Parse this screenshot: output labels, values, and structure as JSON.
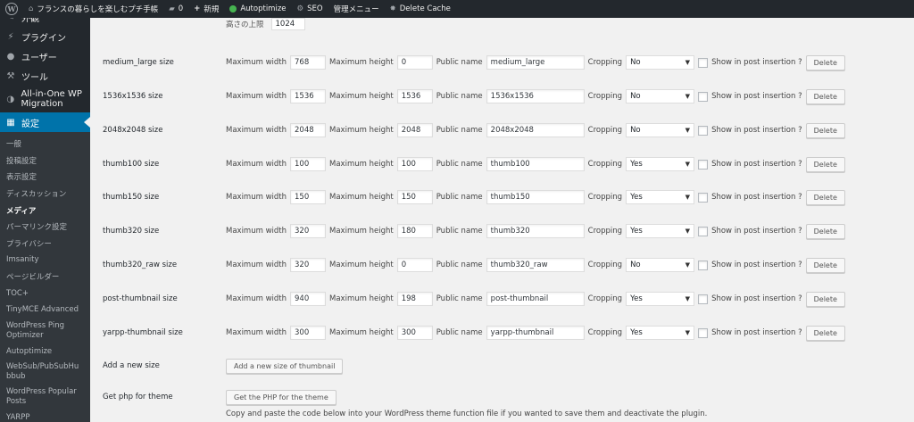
{
  "adminbar": {
    "site_name": "フランスの暮らしを楽しむプチ手帳",
    "comments_count": "0",
    "new_label": "新規",
    "autoptimize": "Autoptimize",
    "seo": "SEO",
    "admin_menu": "管理メニュー",
    "delete_cache": "Delete Cache"
  },
  "sidebar": {
    "top_items": [
      {
        "label": "外観",
        "icon": "paintbrush-icon"
      },
      {
        "label": "プラグイン",
        "icon": "plug-icon"
      },
      {
        "label": "ユーザー",
        "icon": "user-icon"
      },
      {
        "label": "ツール",
        "icon": "wrench-icon"
      },
      {
        "label": "All-in-One WP Migration",
        "icon": "migration-icon"
      },
      {
        "label": "設定",
        "icon": "settings-icon"
      }
    ],
    "sub_items": [
      "一般",
      "投稿設定",
      "表示設定",
      "ディスカッション",
      "メディア",
      "パーマリンク設定",
      "プライバシー",
      "Imsanity",
      "ページビルダー",
      "TOC+",
      "TinyMCE Advanced",
      "WordPress Ping Optimizer",
      "Autoptimize",
      "WebSub/PubSubHubbub",
      "WordPress Popular Posts",
      "YARPP"
    ]
  },
  "main": {
    "top_label": "高さの上限",
    "top_value": "1024",
    "labels": {
      "max_width": "Maximum width",
      "max_height": "Maximum height",
      "public_name": "Public name",
      "cropping": "Cropping",
      "show_in_post": "Show in post insertion ?",
      "delete": "Delete"
    },
    "sizes": [
      {
        "name": "medium_large size",
        "width": "768",
        "height": "0",
        "public": "medium_large",
        "crop": "No"
      },
      {
        "name": "1536x1536 size",
        "width": "1536",
        "height": "1536",
        "public": "1536x1536",
        "crop": "No"
      },
      {
        "name": "2048x2048 size",
        "width": "2048",
        "height": "2048",
        "public": "2048x2048",
        "crop": "No"
      },
      {
        "name": "thumb100 size",
        "width": "100",
        "height": "100",
        "public": "thumb100",
        "crop": "Yes"
      },
      {
        "name": "thumb150 size",
        "width": "150",
        "height": "150",
        "public": "thumb150",
        "crop": "Yes"
      },
      {
        "name": "thumb320 size",
        "width": "320",
        "height": "180",
        "public": "thumb320",
        "crop": "Yes"
      },
      {
        "name": "thumb320_raw size",
        "width": "320",
        "height": "0",
        "public": "thumb320_raw",
        "crop": "No"
      },
      {
        "name": "post-thumbnail size",
        "width": "940",
        "height": "198",
        "public": "post-thumbnail",
        "crop": "Yes"
      },
      {
        "name": "yarpp-thumbnail size",
        "width": "300",
        "height": "300",
        "public": "yarpp-thumbnail",
        "crop": "Yes"
      }
    ],
    "add_new_label": "Add a new size",
    "add_new_button": "Add a new size of thumbnail",
    "php_label": "Get php for theme",
    "php_button": "Get the PHP for the theme",
    "php_note": "Copy and paste the code below into your WordPress theme function file if you wanted to save them and deactivate the plugin."
  }
}
